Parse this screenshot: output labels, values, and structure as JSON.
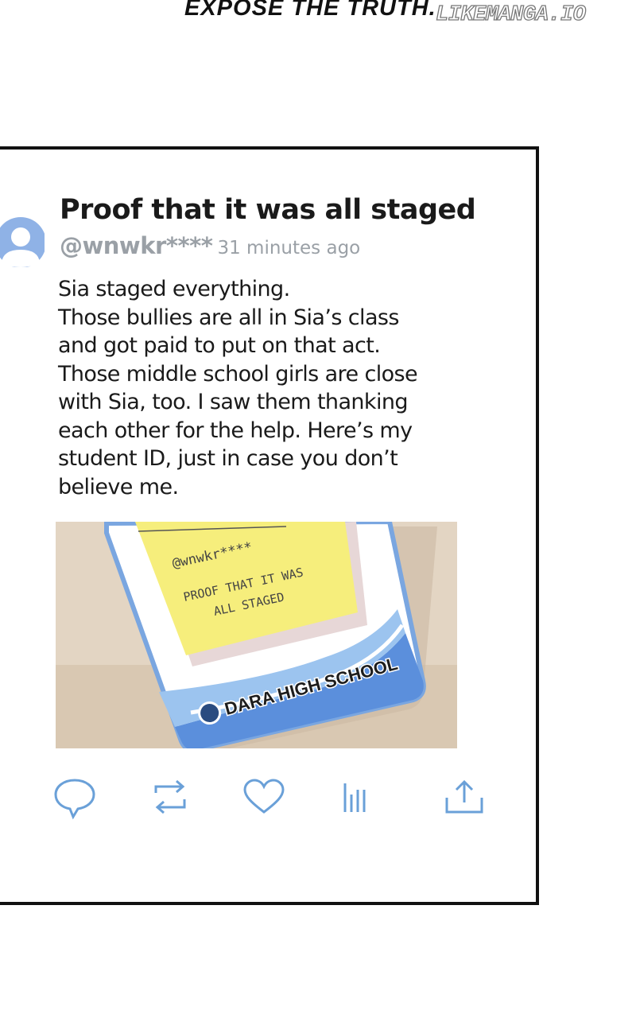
{
  "caption": "EXPOSE THE TRUTH.",
  "watermark": "LIKEMANGA.IO",
  "post": {
    "title": "Proof that it was all staged",
    "handle": "@wnwkr****",
    "time": "31 minutes ago",
    "body_lines": [
      "Sia staged everything.",
      "Those bullies are all in Sia’s class",
      "and got paid to put on that act.",
      "Those middle school girls are close",
      "with Sia, too. I saw them thanking",
      "each other for the help. Here’s my",
      "student ID, just in case you don’t",
      "believe me."
    ],
    "photo": {
      "note_handle": "@wnwkr****",
      "note_line1": "PROOF THAT IT WAS",
      "note_line2": "ALL STAGED",
      "school": "DARA HIGH SCHOOL"
    }
  },
  "colors": {
    "accent": "#6aa0d8",
    "meta_gray": "#9aa0a6",
    "note_yellow": "#f6ee7c"
  },
  "icons": [
    "reply-icon",
    "repost-icon",
    "like-icon",
    "views-icon",
    "share-icon"
  ]
}
